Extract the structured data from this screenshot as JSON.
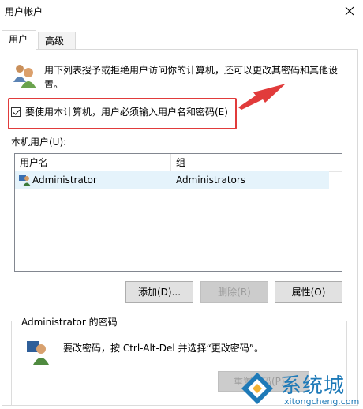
{
  "window": {
    "title": "用户帐户"
  },
  "tabs": [
    {
      "label": "用户"
    },
    {
      "label": "高级"
    }
  ],
  "description": "用下列表授予或拒绝用户访问你的计算机，还可以更改其密码和其他设置。",
  "checkbox": {
    "label": "要使用本计算机，用户必须输入用户名和密码(E)",
    "checked": true
  },
  "users_label": "本机用户(U):",
  "table": {
    "headers": [
      "用户名",
      "组"
    ],
    "rows": [
      {
        "username": "Administrator",
        "group": "Administrators"
      }
    ]
  },
  "buttons": {
    "add": "添加(D)...",
    "remove": "删除(R)",
    "properties": "属性(O)"
  },
  "password_group": {
    "title": "Administrator 的密码",
    "text": "要改密码，按 Ctrl-Alt-Del 并选择“更改密码”。",
    "button": "重置密码(P)..."
  },
  "watermark": {
    "brand": "系统城",
    "url": "xitongcheng.com"
  },
  "colors": {
    "highlight": "#e13b3b",
    "selection": "#e5f3fb",
    "watermark": "#1e7ab8"
  },
  "icons": [
    "close-icon",
    "users-icon",
    "user-row-icon",
    "key-user-icon",
    "watermark-logo"
  ]
}
